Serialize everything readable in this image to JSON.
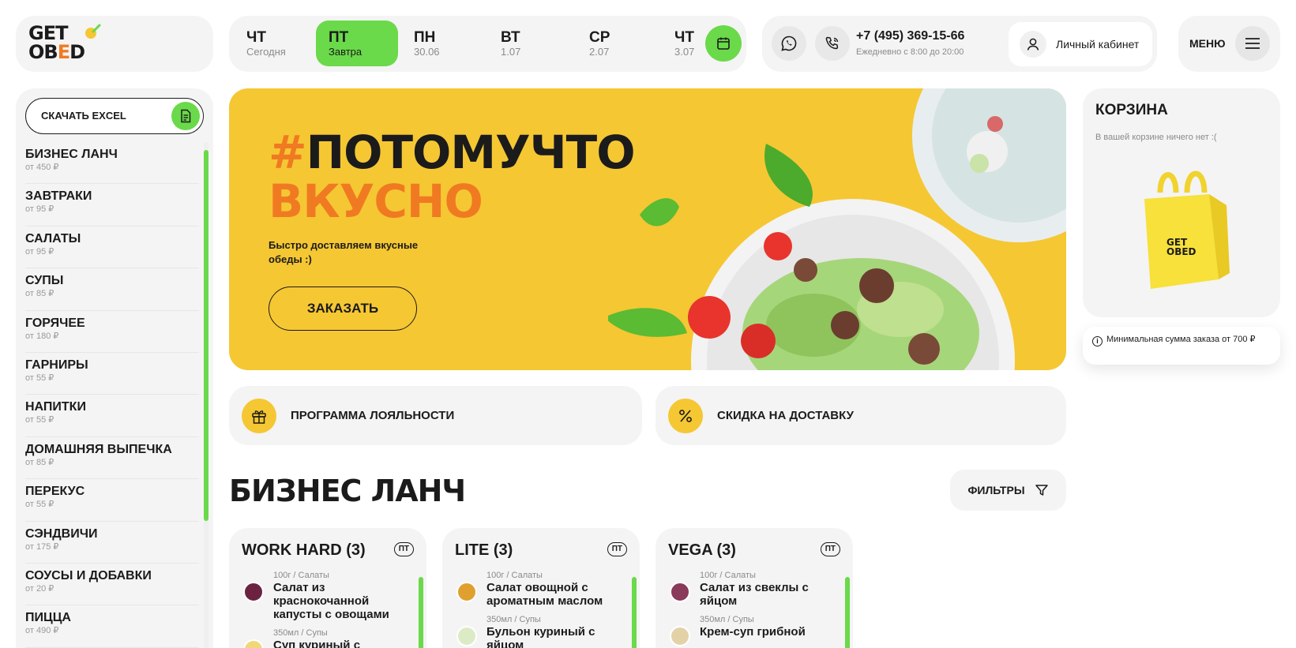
{
  "logo": {
    "line1": "GET",
    "line2a": "OB",
    "line2b": "E",
    "line2c": "D"
  },
  "days": [
    {
      "day": "ЧТ",
      "date": "Сегодня",
      "active": false
    },
    {
      "day": "ПТ",
      "date": "Завтра",
      "active": true
    },
    {
      "day": "ПН",
      "date": "30.06",
      "active": false
    },
    {
      "day": "ВТ",
      "date": "1.07",
      "active": false
    },
    {
      "day": "СР",
      "date": "2.07",
      "active": false
    },
    {
      "day": "ЧТ",
      "date": "3.07",
      "active": false
    }
  ],
  "contacts": {
    "phone": "+7 (495) 369-15-66",
    "hours": "Ежедневно с 8:00 до 20:00",
    "cabinet": "Личный кабинет"
  },
  "menu": {
    "label": "МЕНЮ"
  },
  "sidebar": {
    "excel": "СКАЧАТЬ EXCEL",
    "categories": [
      {
        "name": "БИЗНЕС ЛАНЧ",
        "price": "от 450 ₽"
      },
      {
        "name": "ЗАВТРАКИ",
        "price": "от 95 ₽"
      },
      {
        "name": "САЛАТЫ",
        "price": "от 95 ₽"
      },
      {
        "name": "СУПЫ",
        "price": "от 85 ₽"
      },
      {
        "name": "ГОРЯЧЕЕ",
        "price": "от 180 ₽"
      },
      {
        "name": "ГАРНИРЫ",
        "price": "от 55 ₽"
      },
      {
        "name": "НАПИТКИ",
        "price": "от 55 ₽"
      },
      {
        "name": "ДОМАШНЯЯ ВЫПЕЧКА",
        "price": "от 85 ₽"
      },
      {
        "name": "ПЕРЕКУС",
        "price": "от 55 ₽"
      },
      {
        "name": "СЭНДВИЧИ",
        "price": "от 175 ₽"
      },
      {
        "name": "СОУСЫ И ДОБАВКИ",
        "price": "от 20 ₽"
      },
      {
        "name": "ПИЦЦА",
        "price": "от 490 ₽"
      }
    ]
  },
  "hero": {
    "hash": "#",
    "line1": "ПОТОМУЧТО",
    "line2": "ВКУСНО",
    "subtitle": "Быстро доставляем вкусные обеды :)",
    "cta": "ЗАКАЗАТЬ"
  },
  "promos": {
    "loyalty": "ПРОГРАММА ЛОЯЛЬНОСТИ",
    "discount": "СКИДКА НА ДОСТАВКУ"
  },
  "section": {
    "title": "БИЗНЕС ЛАНЧ",
    "filters": "ФИЛЬТРЫ"
  },
  "products": [
    {
      "title": "WORK HARD (3)",
      "badge": "ПТ",
      "dishes": [
        {
          "meta": "100г / Салаты",
          "name": "Салат из краснокочанной капусты с овощами"
        },
        {
          "meta": "350мл / Супы",
          "name": "Суп куриный с"
        }
      ]
    },
    {
      "title": "LITE (3)",
      "badge": "ПТ",
      "dishes": [
        {
          "meta": "100г / Салаты",
          "name": "Салат овощной с ароматным маслом"
        },
        {
          "meta": "350мл / Супы",
          "name": "Бульон куриный с яйцом"
        }
      ]
    },
    {
      "title": "VEGA (3)",
      "badge": "ПТ",
      "dishes": [
        {
          "meta": "100г / Салаты",
          "name": "Салат из свеклы с яйцом"
        },
        {
          "meta": "350мл / Супы",
          "name": "Крем-суп грибной"
        }
      ]
    }
  ],
  "cart": {
    "title": "КОРЗИНА",
    "empty": "В вашей корзине ничего нет :(",
    "min_sum": "Минимальная сумма заказа от 700 ₽",
    "bag_logo": "GET OBED"
  },
  "colors": {
    "accent_green": "#6ad94a",
    "accent_yellow": "#f5c733",
    "accent_orange": "#f07a22"
  }
}
